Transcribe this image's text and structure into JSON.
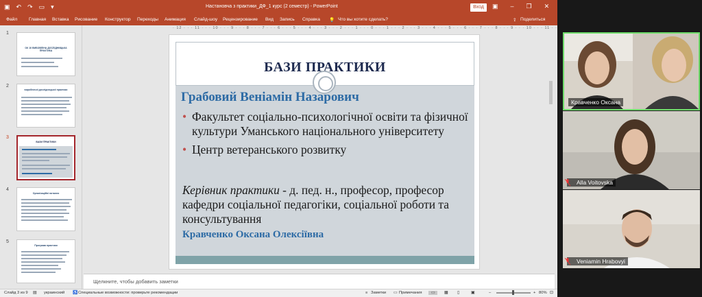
{
  "titlebar": {
    "qat_icons": [
      "save-icon",
      "undo-icon",
      "redo-icon",
      "present-icon",
      "customize-icon"
    ],
    "title": "Настановча з практики_ДФ_1 курс (2 семестр)  -  PowerPoint",
    "login": "Вход",
    "controls": [
      "ribbon-display-icon",
      "minimize-icon",
      "restore-icon",
      "close-icon"
    ]
  },
  "ribbon": {
    "tabs": [
      "Файл",
      "Главная",
      "Вставка",
      "Рисование",
      "Конструктор",
      "Переходы",
      "Анимация",
      "Слайд-шоу",
      "Рецензирование",
      "Вид",
      "Запись",
      "Справка"
    ],
    "tell_me": "Что вы хотите сделать?",
    "share": "Поделиться"
  },
  "thumbnails": [
    {
      "num": "1",
      "title": "ОК 10 ВИБОВЛІНА ДОСЛІДНИЦЬКА ПРАКТИКА"
    },
    {
      "num": "2",
      "title": "виробничої дослідницької практики"
    },
    {
      "num": "3",
      "title": "БАЗИ ПРАКТИКИ"
    },
    {
      "num": "4",
      "title": "Організаційні питання"
    },
    {
      "num": "5",
      "title": "Програма практики"
    }
  ],
  "ruler": "· 12 · · · 11 · · · 10 · · · 9 · · · 8 · · · 7 · · · 6 · · · 5 · · · 4 · · · 3 · · · 2 · · · 1 · · · 0 · · · 1 · · · 2 · · · 3 · · · 4 · · · 5 · · · 6 · · · 7 · · · 8 · · · 9 · · · 10 · · · 11 · · · 12",
  "slide": {
    "title": "БАЗИ ПРАКТИКИ",
    "person": "Грабовий Веніамін Назарович",
    "bullet1": "Факультет соціально-психологічної освіти та фізичної культури Уманського національного університету",
    "bullet2": "Центр ветеранського розвитку",
    "supervisor_label": "Керівник практики",
    "supervisor_text": " - д. пед. н., професор, професор кафедри соціальної педагогіки, соціальної роботи та консультування",
    "supervisor_name": "Кравченко Оксана Олексіївна"
  },
  "notes_placeholder": "Щелкните, чтобы добавить заметки",
  "status": {
    "slide": "Слайд 3 из 9",
    "language": "украинский",
    "accessibility": "Специальные возможности: проверьте рекомендации",
    "notes": "Заметки",
    "comments": "Примечания",
    "zoom": "80%"
  },
  "participants": [
    {
      "name": "Кравченко Оксана",
      "muted": false
    },
    {
      "name": "Alla Voitovska",
      "muted": true
    },
    {
      "name": "Veniamin Hrabovyi",
      "muted": true
    }
  ],
  "colors": {
    "ribbon": "#b7472a",
    "title_navy": "#1d2a4f",
    "heading_blue": "#2d6ba5",
    "bullet_red": "#c0504d",
    "speaker_border": "#6fdc6a"
  }
}
